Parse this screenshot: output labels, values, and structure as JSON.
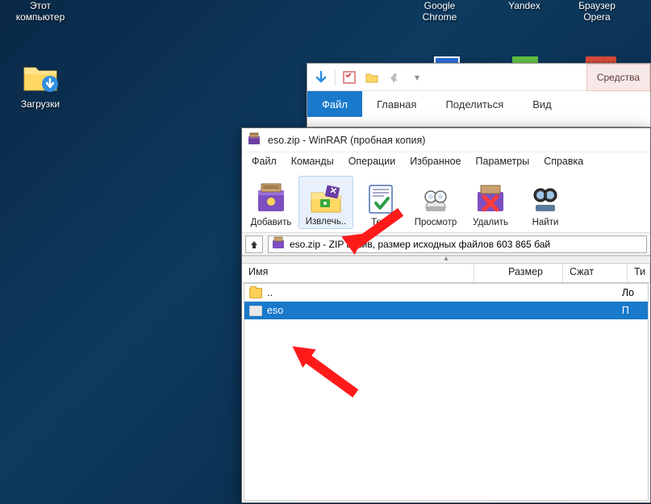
{
  "desktop": {
    "this_pc": "Этот\nкомпьютер",
    "downloads": "Загрузки",
    "chrome": "Google\nChrome",
    "yandex": "Yandex",
    "opera": "Браузер\nOpera"
  },
  "explorer": {
    "tools": "Средства",
    "tabs": {
      "file": "Файл",
      "home": "Главная",
      "share": "Поделиться",
      "view": "Вид"
    }
  },
  "winrar": {
    "title": "eso.zip - WinRAR (пробная копия)",
    "menu": {
      "file": "Файл",
      "commands": "Команды",
      "operations": "Операции",
      "favorites": "Избранное",
      "options": "Параметры",
      "help": "Справка"
    },
    "toolbar": {
      "add": "Добавить",
      "extract": "Извлечь..",
      "test": "Тест",
      "view": "Просмотр",
      "delete": "Удалить",
      "find": "Найти"
    },
    "path": "eso.zip - ZIP архив, размер исходных файлов 603 865 бай",
    "columns": {
      "name": "Имя",
      "size": "Размер",
      "compressed": "Сжат",
      "type": "Ти"
    },
    "rows": {
      "parent": "..",
      "parent_type": "Ло",
      "folder": "eso",
      "folder_type": "П"
    }
  }
}
